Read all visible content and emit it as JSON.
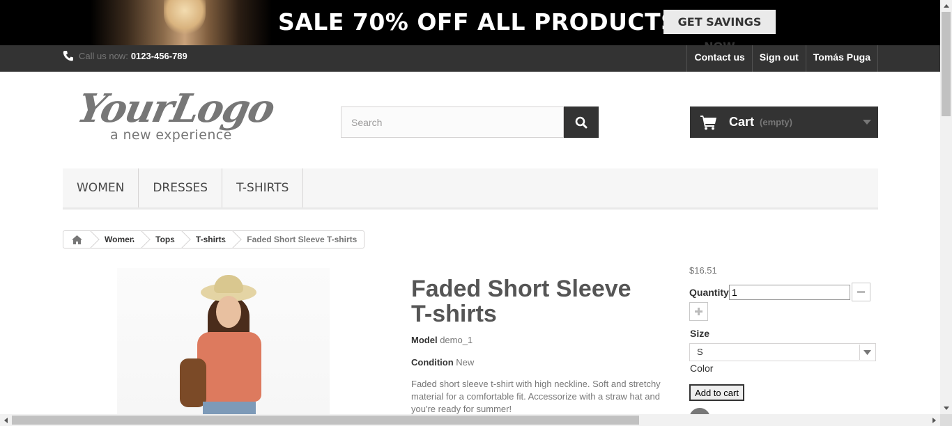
{
  "promo": {
    "text": "SALE 70% OFF ALL PRODUCTS",
    "button": "GET SAVINGS NOW"
  },
  "topbar": {
    "call_label": "Call us now:",
    "phone": "0123-456-789",
    "links": [
      "Contact us",
      "Sign out",
      "Tomás Puga"
    ]
  },
  "header": {
    "logo_main": "YourLogo",
    "logo_tagline": "a new experience",
    "search_placeholder": "Search",
    "cart_label": "Cart",
    "cart_status": "(empty)"
  },
  "menu": [
    "WOMEN",
    "DRESSES",
    "T-SHIRTS"
  ],
  "breadcrumb": [
    "Women",
    "Tops",
    "T-shirts",
    "Faded Short Sleeve T-shirts"
  ],
  "product": {
    "title": "Faded Short Sleeve T-shirts",
    "model_label": "Model",
    "model": "demo_1",
    "condition_label": "Condition",
    "condition": "New",
    "description": "Faded short sleeve t-shirt with high neckline. Soft and stretchy material for a comfortable fit. Accessorize with a straw hat and you're ready for summer!"
  },
  "buy": {
    "price": "$16.51",
    "quantity_label": "Quantity",
    "quantity": "1",
    "size_label": "Size",
    "size": "S",
    "color_label": "Color",
    "add_to_cart": "Add to cart"
  },
  "colors": {
    "dark_bar": "#333333",
    "menu_bg": "#f6f6f6",
    "promo_bg": "#000000"
  },
  "icons": [
    "phone-icon",
    "search-icon",
    "cart-icon",
    "chevron-down-icon",
    "home-icon",
    "minus-icon",
    "plus-icon"
  ]
}
